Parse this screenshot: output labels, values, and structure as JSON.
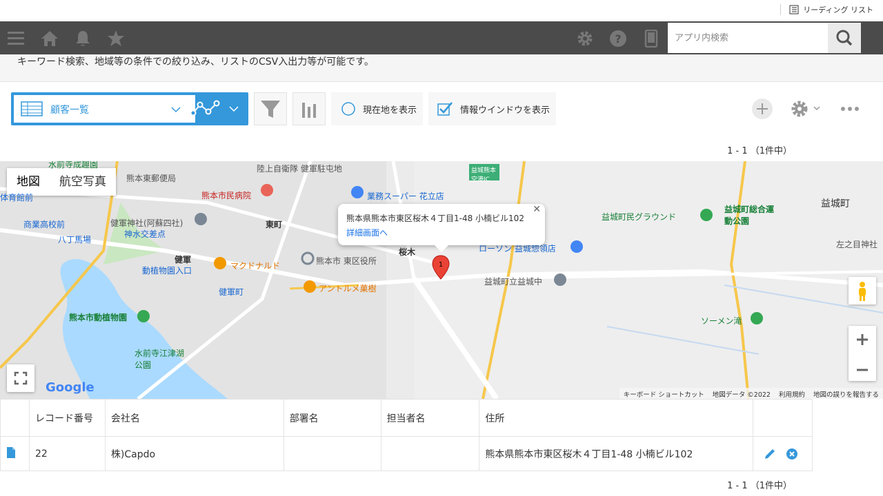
{
  "reading_list": "リーディング リスト",
  "search": {
    "placeholder": "アプリ内検索"
  },
  "description": "キーワード検索、地域等の条件での絞り込み、リストのCSV入出力等が可能です。",
  "view": {
    "name": "顧客一覧"
  },
  "options": {
    "current_location": "現在地を表示",
    "info_window": "情報ウインドウを表示"
  },
  "pagination": {
    "top": "1 - 1  （1件中）",
    "bottom": "1 - 1  （1件中）"
  },
  "map": {
    "type_map": "地図",
    "type_satellite": "航空写真",
    "marker_label": "1",
    "info_address": "熊本県熊本市東区桜木４丁目1-48 小楠ビル102",
    "info_link": "詳細画面へ",
    "labels": {
      "l1": "熊本東郵便局",
      "l2": "陸上自衛隊 健軍駐屯地",
      "l3": "熊本市民病院",
      "l4": "業務スーパー 花立店",
      "l5": "健軍神社(阿蘇四社)",
      "l6": "神水交差点",
      "l7": "東町",
      "l8": "商業高校前",
      "l9": "八丁馬場",
      "l10": "健軍",
      "l11": "マクドナルド",
      "l12": "熊本市 東区役所",
      "l13": "動植物園入口",
      "l14": "健軍町",
      "l15": "アントルメ菓樹",
      "l16": "桜木",
      "l17": "益城町立益城中",
      "l18": "熊本市動植物園",
      "l19": "水前寺江津湖公園",
      "l20": "益城町民グラウンド",
      "l21": "益城町総合運動公園",
      "l22": "益城町",
      "l23": "左之目神社",
      "l24": "ソーメン滝",
      "l25": "ローソン 益城惣領店",
      "l26": "益城熊本空港IC",
      "l27": "体育館前",
      "l28": "水前寺成趣園"
    },
    "google": "Google",
    "footer": {
      "shortcuts": "キーボード ショートカット",
      "mapdata": "地図データ ©2022",
      "terms": "利用規約",
      "report": "地図の誤りを報告する"
    }
  },
  "table": {
    "headers": [
      "レコード番号",
      "会社名",
      "部署名",
      "担当者名",
      "住所"
    ],
    "rows": [
      {
        "record": "22",
        "company": "株)Capdo",
        "dept": "",
        "person": "",
        "address": "熊本県熊本市東区桜木４丁目1-48 小楠ビル102"
      }
    ]
  },
  "colors": {
    "accent": "#3498db",
    "header": "#4b4b4b",
    "marker": "#ea4335"
  }
}
